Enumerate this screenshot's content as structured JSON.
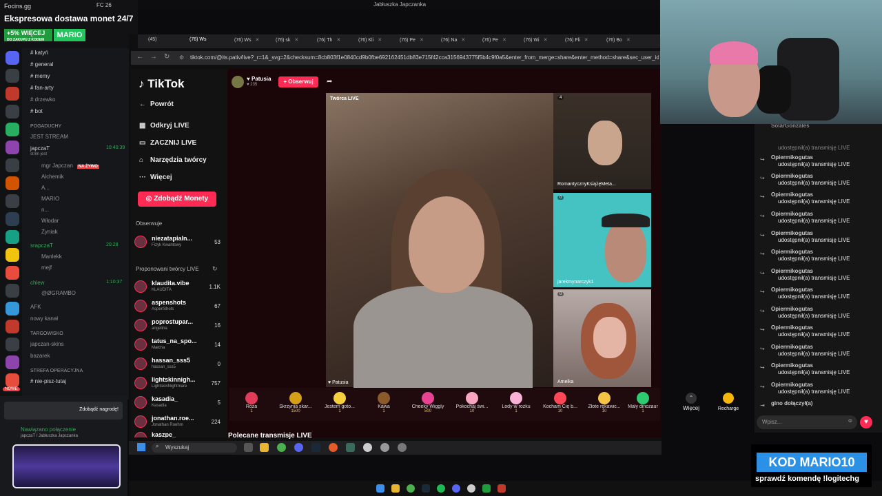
{
  "promo": {
    "brand": "Focins.gg",
    "tagline": "Ekspresowa dostawa monet 24/7",
    "bonus": "+5% WIĘCEJ",
    "bonus_sub": "DO ZAKUPU Z KODEM",
    "code": "MARIO"
  },
  "window_title": "Jabłuszka Japczanka",
  "tray_top": "FC 26",
  "discord": {
    "channels": [
      {
        "name": "# katyń",
        "type": "text"
      },
      {
        "name": "# general",
        "type": "text"
      },
      {
        "name": "# memy",
        "type": "text"
      },
      {
        "name": "# fan-arty",
        "type": "text"
      },
      {
        "name": "# drzewko",
        "type": "text"
      },
      {
        "name": "# bot",
        "type": "text"
      }
    ],
    "groups": [
      "POGADUCHY",
      "TARGOWISKO",
      "STREFA OPERACYJNA"
    ],
    "voice": [
      {
        "name": "JEST STREAM"
      },
      {
        "name": "japczaT",
        "sub": "strim jest",
        "time": "10:40:39"
      },
      {
        "name": "mgr Japczan",
        "badge": "NA ŻYWO"
      },
      {
        "name": "Alchemik"
      },
      {
        "name": "A..."
      },
      {
        "name": "MARIO"
      },
      {
        "name": "n..."
      },
      {
        "name": "Włodar"
      },
      {
        "name": "Żyniak"
      },
      {
        "name": "srapczaT",
        "time": "20:28"
      },
      {
        "name": "Manlekk"
      },
      {
        "name": "mejf"
      },
      {
        "name": "chlew",
        "time": "1:10:37"
      },
      {
        "name": "@ØGRAMBO"
      },
      {
        "name": "AFK"
      },
      {
        "name": "nowy kanał"
      },
      {
        "name": "japczan-skins"
      },
      {
        "name": "bazarek"
      },
      {
        "name": "# nie-pisz-tutaj"
      }
    ],
    "ad_button": "Zdobądź nagrodę!",
    "connection": "Nawiązano połączenie",
    "connection_sub": "japczaT / Jabłuszka Japczanka",
    "server_badge": "NOWE"
  },
  "browser": {
    "tabs": [
      "(45)",
      "(76) Ws",
      "(76) sk",
      "(76) Th",
      "(76) Kli",
      "(76) Pe",
      "(76) Na",
      "(76) Pe",
      "(76) Wi",
      "(76) Fli",
      "(76) Bo"
    ],
    "url": "tiktok.com/@its.pativ/live?_r=1&_svg=2&checksum=8cb803f1e0840cd9b0fbe692162451db83e715f42cca3156943775f5b4c9f0a5&enter_from_merge=share&enter_method=share&sec_user_id=M"
  },
  "tiktok": {
    "logo": "TikTok",
    "nav": [
      "Powrót",
      "Odkryj LIVE",
      "ZACZNIJ LIVE",
      "Narzędzia twórcy",
      "Więcej"
    ],
    "coins_button": "Zdobądź Monety",
    "followed_header": "Obserwuje",
    "followed": [
      {
        "name": "niezatapialn...",
        "sub": "Fizyk Kwantowy",
        "count": "53"
      }
    ],
    "suggested_header": "Proponowani twórcy LIVE",
    "suggested": [
      {
        "name": "klaudita.vibe",
        "sub": "KLAUDITA",
        "count": "1.1K"
      },
      {
        "name": "aspenshots",
        "sub": "AspenShots",
        "count": "67"
      },
      {
        "name": "poprostupar...",
        "sub": "angelina",
        "count": "16"
      },
      {
        "name": "tatus_na_spo...",
        "sub": "Małcha",
        "count": "14"
      },
      {
        "name": "hassan_sss5",
        "sub": "hassan_sss5",
        "count": "0"
      },
      {
        "name": "lightskinnigh...",
        "sub": "LightskinNightmare",
        "count": "757"
      },
      {
        "name": "kasadia_",
        "sub": "Kasadia",
        "count": "5"
      },
      {
        "name": "jonathan.roe...",
        "sub": "Jonathan Roehm",
        "count": "224"
      },
      {
        "name": "kaszpe_",
        "sub": "",
        "count": ""
      }
    ],
    "host": {
      "name": "Patusia",
      "likes": "235",
      "follow": "+ Obserwuj"
    },
    "main_label": "Twórca LIVE",
    "main_name": "Patusia",
    "guests": [
      {
        "name": "RomantycznyKsiążęMeta...",
        "count": "4"
      },
      {
        "name": "jarekmynarczyk1",
        "count": "0"
      },
      {
        "name": "Amelka",
        "count": "0"
      }
    ],
    "gifts": [
      {
        "name": "Róża",
        "price": "1"
      },
      {
        "name": "Skrzynia skar...",
        "price": "1500"
      },
      {
        "name": "Jestem goto...",
        "price": "1"
      },
      {
        "name": "Kawa",
        "price": "1"
      },
      {
        "name": "Cheeky Wiggly",
        "price": "500"
      },
      {
        "name": "Pokochaj świ...",
        "price": "10"
      },
      {
        "name": "Lody w rożku",
        "price": "1"
      },
      {
        "name": "Kocham Cię b...",
        "price": "10"
      },
      {
        "name": "Złote rękawic...",
        "price": "10"
      },
      {
        "name": "Mały dinozaur",
        "price": "1"
      }
    ],
    "more": "Więcej",
    "recharge": "Recharge",
    "recommended": "Polecane transmisje LIVE"
  },
  "chat": {
    "top_user": "SolarGonzales",
    "top_msg": "udostępnił(a) transmisję LIVE",
    "messages": [
      {
        "user": "Opiermikogutas",
        "msg": "udostępnił(a) transmisję LIVE"
      },
      {
        "user": "Opiermikogutas",
        "msg": "udostępnił(a) transmisję LIVE"
      },
      {
        "user": "Opiermikogutas",
        "msg": "udostępnił(a) transmisję LIVE"
      },
      {
        "user": "Opiermikogutas",
        "msg": "udostępnił(a) transmisję LIVE"
      },
      {
        "user": "Opiermikogutas",
        "msg": "udostępnił(a) transmisję LIVE"
      },
      {
        "user": "Opiermikogutas",
        "msg": "udostępnił(a) transmisję LIVE"
      },
      {
        "user": "Opiermikogutas",
        "msg": "udostępnił(a) transmisję LIVE"
      },
      {
        "user": "Opiermikogutas",
        "msg": "udostępnił(a) transmisję LIVE"
      },
      {
        "user": "Opiermikogutas",
        "msg": "udostępnił(a) transmisję LIVE"
      },
      {
        "user": "Opiermikogutas",
        "msg": "udostępnił(a) transmisję LIVE"
      },
      {
        "user": "Opiermikogutas",
        "msg": "udostępnił(a) transmisję LIVE"
      },
      {
        "user": "Opiermikogutas",
        "msg": "udostępnił(a) transmisję LIVE"
      },
      {
        "user": "Opiermikogutas",
        "msg": "udostępnił(a) transmisję LIVE"
      },
      {
        "user": "Opiermikogutas",
        "msg": "udostępnił(a) transmisję LIVE"
      }
    ],
    "joined": "gino dołączył(a)",
    "placeholder": "Wpisz..."
  },
  "taskbar": {
    "search": "Wyszukaj"
  },
  "overlay": {
    "code": "KOD MARIO10",
    "cmd": "sprawdź komendę !logitechg"
  },
  "colors": {
    "accent": "#fe2c55",
    "discord_green": "#3ba55d",
    "promo_green": "#22c55e",
    "overlay_blue": "#2b91e6"
  }
}
